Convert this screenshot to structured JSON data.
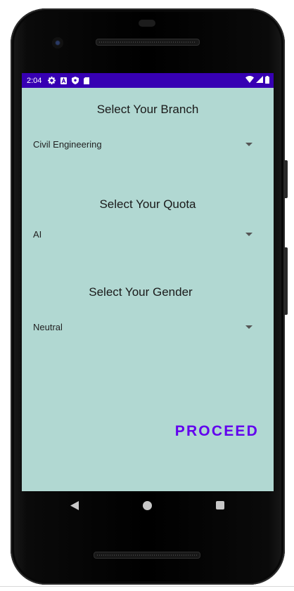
{
  "status_bar": {
    "time": "2:04",
    "icons_left": [
      "settings-icon",
      "a-badge-icon",
      "shield-icon",
      "sd-card-icon"
    ],
    "icons_right": [
      "wifi-icon",
      "signal-icon",
      "battery-icon"
    ],
    "background": "#3700b3"
  },
  "screen": {
    "background": "#b1d8d2"
  },
  "branch": {
    "title": "Select Your Branch",
    "value": "Civil Engineering"
  },
  "quota": {
    "title": "Select Your Quota",
    "value": "AI"
  },
  "gender": {
    "title": "Select Your Gender",
    "value": "Neutral"
  },
  "proceed_label": "PROCEED",
  "accent_color": "#6200ee",
  "nav_bar": {
    "buttons": [
      "back-icon",
      "home-icon",
      "recents-icon"
    ]
  }
}
